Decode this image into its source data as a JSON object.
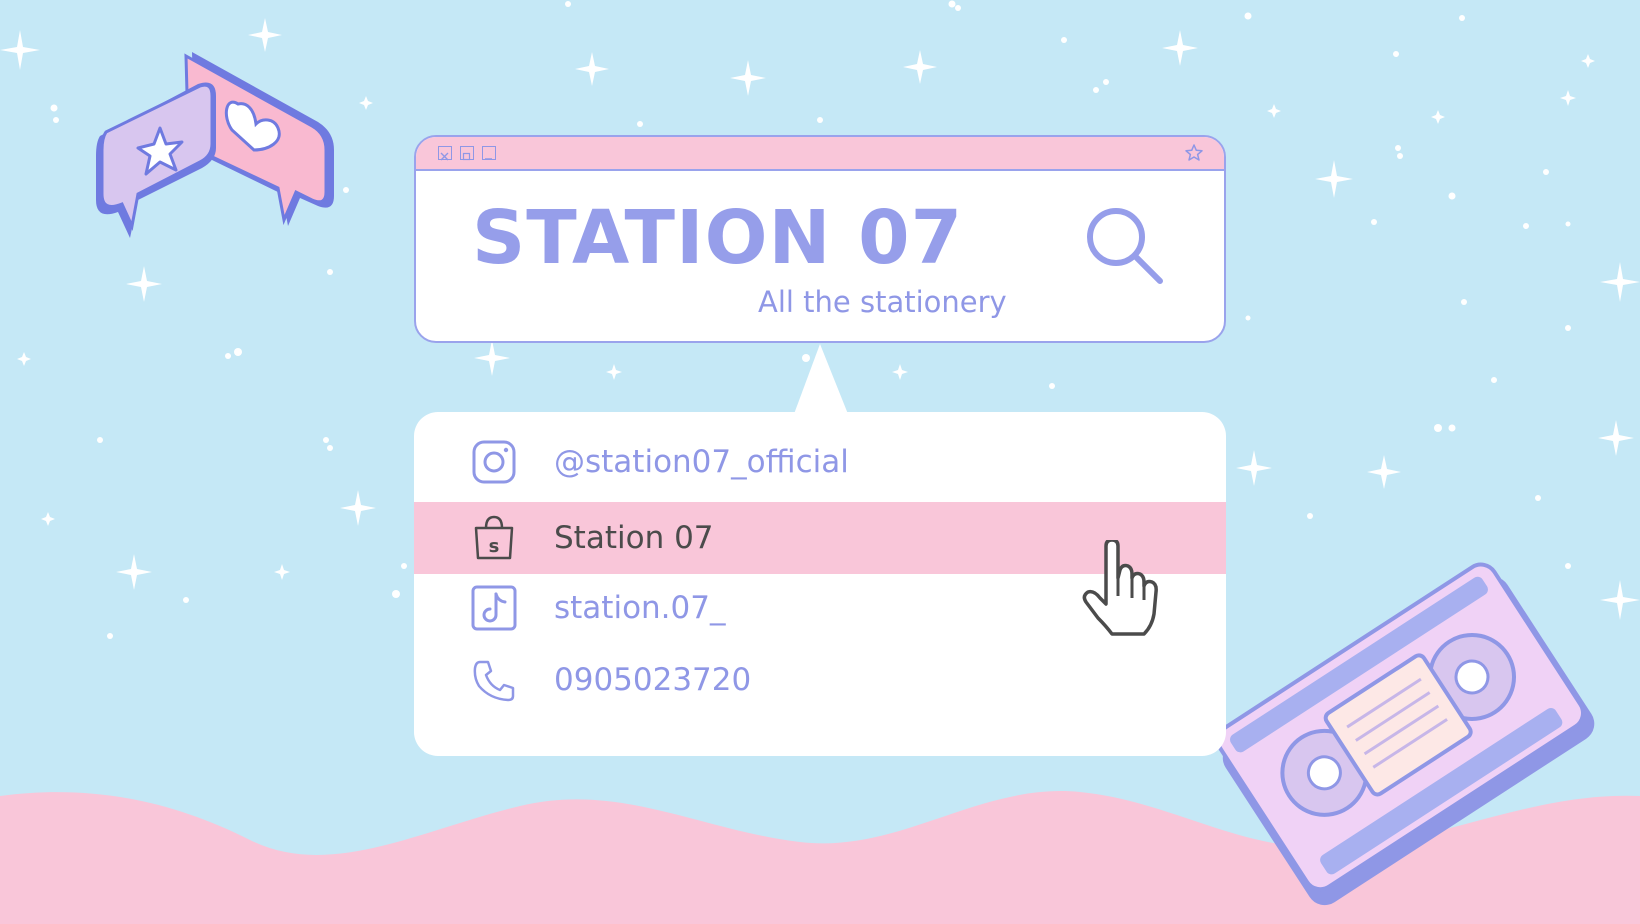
{
  "colors": {
    "background": "#c5e8f6",
    "pink": "#f9c6d9",
    "periwinkle": "#969eea",
    "white": "#ffffff"
  },
  "window": {
    "title_buttons": [
      "close-icon",
      "maximize-icon",
      "minimize-icon"
    ],
    "bookmark_icon": "star-icon",
    "brand_title": "STATION 07",
    "brand_subtitle": "All the stationery",
    "search_icon": "search-icon"
  },
  "contacts": [
    {
      "icon": "instagram-icon",
      "label": "@station07_official",
      "highlighted": false
    },
    {
      "icon": "shopee-bag-icon",
      "label": "Station 07",
      "highlighted": true
    },
    {
      "icon": "tiktok-icon",
      "label": "station.07_",
      "highlighted": false
    },
    {
      "icon": "phone-icon",
      "label": "0905023720",
      "highlighted": false
    }
  ],
  "decorations": [
    "chat-bubble-star-icon",
    "chat-bubble-heart-icon",
    "cassette-tape-icon",
    "hand-pointer-cursor-icon",
    "sparkle-stars",
    "pink-wave"
  ]
}
